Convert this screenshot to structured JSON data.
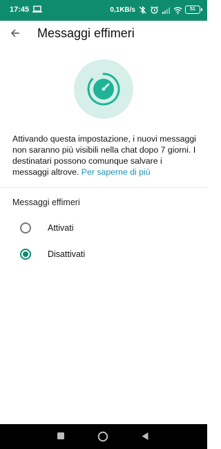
{
  "status_bar": {
    "time": "17:45",
    "net_speed": "0,1KB/s",
    "battery_level": "51",
    "icons": [
      "laptop-icon",
      "bluetooth-off-icon",
      "alarm-icon",
      "cellular-icon",
      "wifi-icon",
      "battery-icon"
    ]
  },
  "app_bar": {
    "back_icon": "arrow-left-icon",
    "title": "Messaggi effimeri"
  },
  "hero": {
    "icon": "timer-icon",
    "circle_color": "#d6efe8",
    "accent_color": "#1fb398"
  },
  "description": {
    "text": "Attivando questa impostazione, i nuovi messaggi non saranno più visibili nella chat dopo 7 giorni. I destinatari possono comunque salvare i messaggi altrove.",
    "link_text": "Per saperne di più",
    "link_color": "#1a92b3"
  },
  "setting": {
    "section_label": "Messaggi effimeri",
    "options": [
      {
        "label": "Attivati",
        "selected": false
      },
      {
        "label": "Disattivati",
        "selected": true
      }
    ],
    "selected_color": "#0a8c73"
  },
  "nav_bar": {
    "icons": [
      "recents-square-icon",
      "home-circle-icon",
      "back-triangle-icon"
    ]
  },
  "colors": {
    "status_bar_bg": "#0f8c6e",
    "nav_bar_bg": "#000000"
  }
}
